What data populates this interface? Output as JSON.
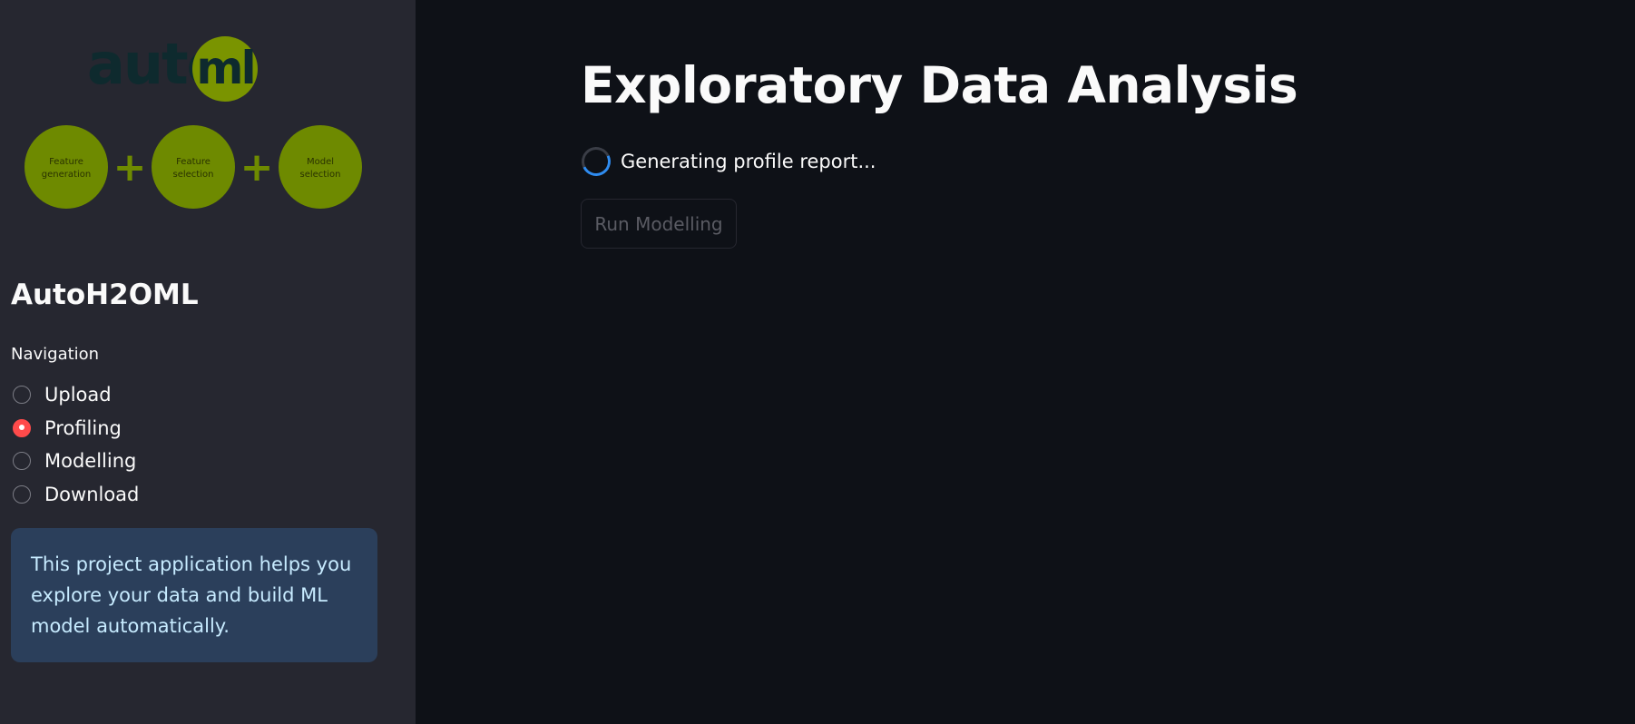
{
  "sidebar": {
    "logo": {
      "wordmark": "auto",
      "badge": "ml",
      "steps": [
        "Feature generation",
        "Feature selection",
        "Model selection"
      ],
      "step_lines": [
        [
          "Feature",
          "generation"
        ],
        [
          "Feature",
          "selection"
        ],
        [
          "Model",
          "selection"
        ]
      ],
      "connector": "+",
      "colors": {
        "wordmark": "#0e2a2e",
        "badge": "#7a9400",
        "step_fill": "#6e8a00",
        "step_text": "#2a3300"
      }
    },
    "title": "AutoH2OML",
    "navigation": {
      "label": "Navigation",
      "options": [
        {
          "label": "Upload",
          "selected": false
        },
        {
          "label": "Profiling",
          "selected": true
        },
        {
          "label": "Modelling",
          "selected": false
        },
        {
          "label": "Download",
          "selected": false
        }
      ]
    },
    "info": "This project application helps you explore your data and build ML model automatically."
  },
  "main": {
    "title": "Exploratory Data Analysis",
    "status": "Generating profile report...",
    "run_button": {
      "label": "Run Modelling",
      "disabled": true
    }
  },
  "colors": {
    "sidebar_bg": "#262730",
    "main_bg": "#0e1117",
    "accent": "#ff4b4b",
    "spinner": "#2f8cf0",
    "info_bg": "#2b3f5b",
    "info_text": "#c7ebff"
  }
}
